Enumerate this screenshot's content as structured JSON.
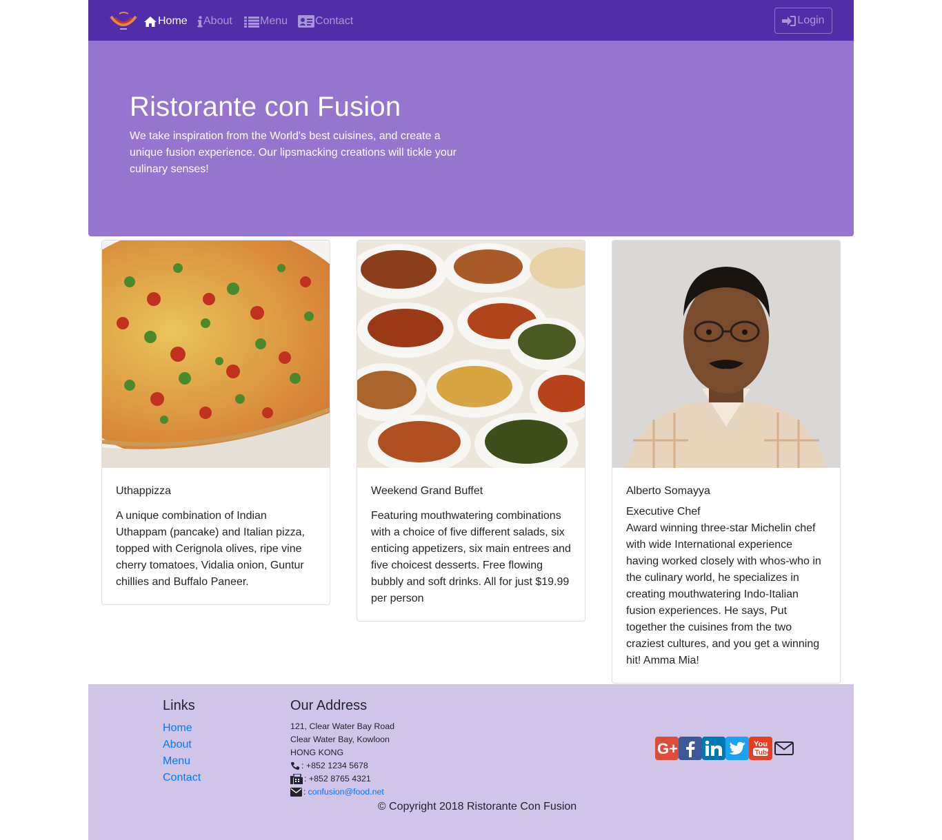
{
  "nav": {
    "items": [
      {
        "label": "Home",
        "icon": "home-icon",
        "active": true
      },
      {
        "label": "About",
        "icon": "info-icon"
      },
      {
        "label": "Menu",
        "icon": "list-icon"
      },
      {
        "label": "Contact",
        "icon": "address-card-icon"
      }
    ],
    "login_label": "Login"
  },
  "jumbotron": {
    "title": "Ristorante con Fusion",
    "text": "We take inspiration from the World's best cuisines, and create a unique fusion experience. Our lipsmacking creations will tickle your culinary senses!"
  },
  "cards": [
    {
      "title": "Uthappizza",
      "text": "A unique combination of Indian Uthappam (pancake) and Italian pizza, topped with Cerignola olives, ripe vine cherry tomatoes, Vidalia onion, Guntur chillies and Buffalo Paneer."
    },
    {
      "title": "Weekend Grand Buffet",
      "text": "Featuring mouthwatering combinations with a choice of five different salads, six enticing appetizers, six main entrees and five choicest desserts. Free flowing bubbly and soft drinks. All for just $19.99 per person"
    },
    {
      "title": "Alberto Somayya",
      "subtitle": "Executive Chef",
      "text": "Award winning three-star Michelin chef with wide International experience having worked closely with whos-who in the culinary world, he specializes in creating mouthwatering Indo-Italian fusion experiences. He says, Put together the cuisines from the two craziest cultures, and you get a winning hit! Amma Mia!"
    }
  ],
  "footer": {
    "links_heading": "Links",
    "links": [
      "Home",
      "About",
      "Menu",
      "Contact"
    ],
    "address_heading": "Our Address",
    "address_lines": [
      "121, Clear Water Bay Road",
      "Clear Water Bay, Kowloon",
      "HONG KONG"
    ],
    "phone": ": +852 1234 5678",
    "fax": ": +852 8765 4321",
    "email_prefix": ":",
    "email": "confusion@food.net",
    "social": [
      "google-plus-icon",
      "facebook-icon",
      "linkedin-icon",
      "twitter-icon",
      "youtube-icon",
      "envelope-icon"
    ],
    "copyright": "© Copyright 2018 Ristorante Con Fusion"
  },
  "colors": {
    "navbar": "#512DA8",
    "jumbotron": "#9575CD",
    "footer": "#D1C4E9",
    "link": "#007bff"
  }
}
